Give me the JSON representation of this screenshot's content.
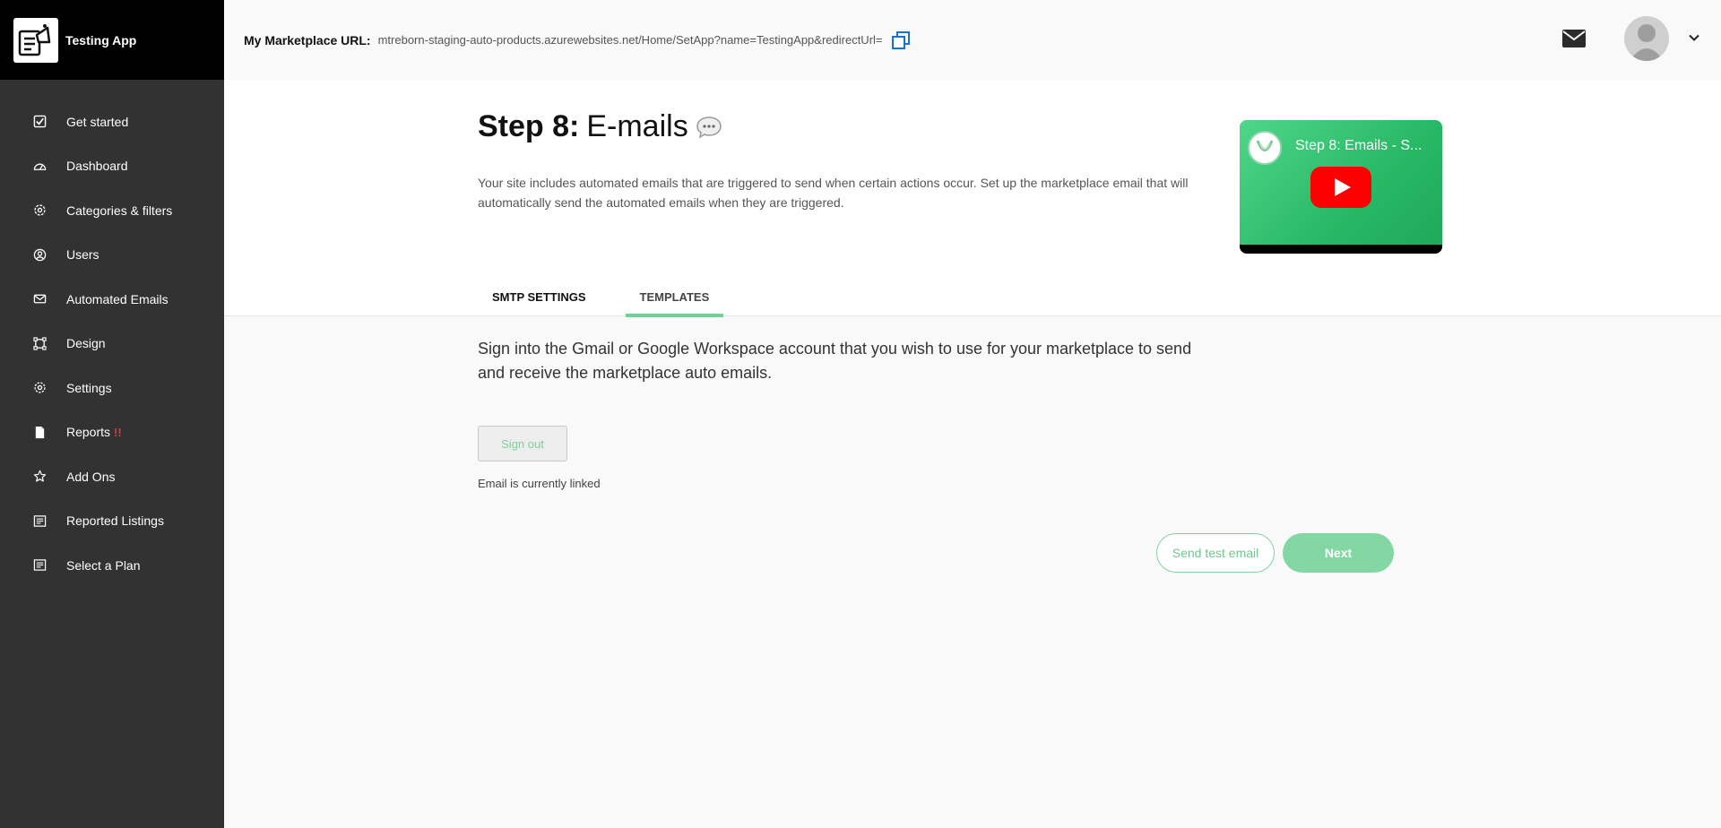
{
  "app": {
    "name": "Testing App"
  },
  "sidebar": {
    "items": [
      {
        "label": "Get started",
        "icon": "checkbox-icon"
      },
      {
        "label": "Dashboard",
        "icon": "gauge-icon"
      },
      {
        "label": "Categories & filters",
        "icon": "filter-gear-icon"
      },
      {
        "label": "Users",
        "icon": "user-circle-icon"
      },
      {
        "label": "Automated Emails",
        "icon": "envelope-icon"
      },
      {
        "label": "Design",
        "icon": "design-frame-icon"
      },
      {
        "label": "Settings",
        "icon": "gear-icon"
      },
      {
        "label": "Reports",
        "icon": "document-icon",
        "badge": "!!"
      },
      {
        "label": "Add Ons",
        "icon": "star-icon"
      },
      {
        "label": "Reported Listings",
        "icon": "list-icon"
      },
      {
        "label": "Select a Plan",
        "icon": "list-icon"
      }
    ]
  },
  "topbar": {
    "url_label": "My Marketplace URL:",
    "url_value": "mtreborn-staging-auto-products.azurewebsites.net/Home/SetApp?name=TestingApp&redirectUrl="
  },
  "page": {
    "title_step": "Step 8:",
    "title_name": "E-mails",
    "description": "Your site includes automated emails that are triggered to send when certain actions occur. Set up the marketplace email that will automatically send the automated emails when they are triggered."
  },
  "video": {
    "title": "Step 8: Emails - S..."
  },
  "tabs": [
    {
      "label": "SMTP SETTINGS",
      "active": false
    },
    {
      "label": "TEMPLATES",
      "active": true
    }
  ],
  "smtp": {
    "instructions": "Sign into the Gmail or Google Workspace account that you wish to use for your marketplace to send and receive the marketplace auto emails.",
    "sign_out_label": "Sign out",
    "status_text": "Email is currently linked"
  },
  "actions": {
    "send_test_label": "Send test email",
    "next_label": "Next"
  },
  "colors": {
    "sidebar_bg": "#323232",
    "brand_bg": "#000000",
    "accent_green": "#82d7a3",
    "badge_red": "#e53935",
    "link_blue": "#1a73c8"
  }
}
